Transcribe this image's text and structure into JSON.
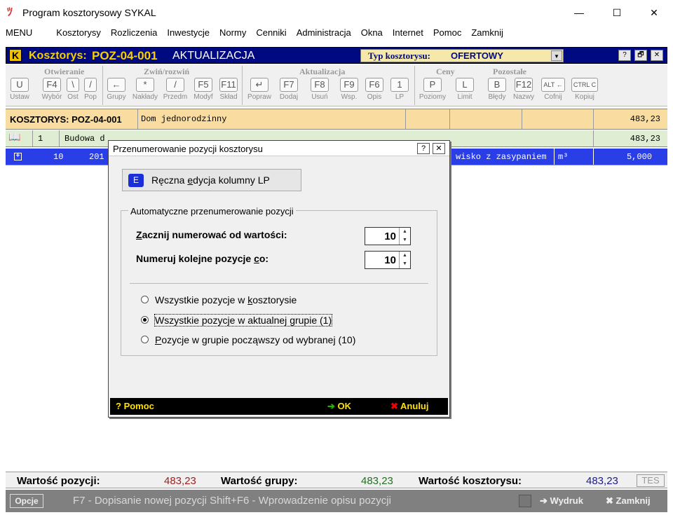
{
  "window": {
    "title": "Program kosztorysowy SYKAL",
    "minimize": "—",
    "maximize": "☐",
    "close": "✕"
  },
  "menu": [
    "MENU",
    "Kosztorysy",
    "Rozliczenia",
    "Inwestycje",
    "Normy",
    "Cenniki",
    "Administracja",
    "Okna",
    "Internet",
    "Pomoc",
    "Zamknij"
  ],
  "header": {
    "logo": "K",
    "label": "Kosztorys:",
    "code": "POZ-04-001",
    "mode": "AKTUALIZACJA",
    "typ_label": "Typ kosztorysu:",
    "typ_value": "OFERTOWY",
    "btn_help": "?",
    "btn_restore": "🗗",
    "btn_close": "✕"
  },
  "toolbar": {
    "groups": [
      "Otwieranie",
      "Zwiń/rozwiń",
      "Aktualizacja",
      "Ceny",
      "Pozostałe"
    ],
    "buttons": [
      {
        "key": "U",
        "label": "Ustaw"
      },
      {
        "key": "F4",
        "label": "Wybór"
      },
      {
        "key": "\\",
        "label": "Ost"
      },
      {
        "key": "/",
        "label": "Pop"
      },
      {
        "key": "←",
        "label": "Grupy"
      },
      {
        "key": "*",
        "label": "Nakłady"
      },
      {
        "key": "/",
        "label": "Przedm"
      },
      {
        "key": "F5",
        "label": "Modyf"
      },
      {
        "key": "F11",
        "label": "Skład"
      },
      {
        "key": "↵",
        "label": "Popraw"
      },
      {
        "key": "F7",
        "label": "Dodaj"
      },
      {
        "key": "F8",
        "label": "Usuń"
      },
      {
        "key": "F9",
        "label": "Wsp."
      },
      {
        "key": "F6",
        "label": "Opis"
      },
      {
        "key": "1",
        "label": "LP"
      },
      {
        "key": "P",
        "label": "Poziomy"
      },
      {
        "key": "L",
        "label": "Limit"
      },
      {
        "key": "B",
        "label": "Błędy"
      },
      {
        "key": "F12",
        "label": "Nazwy"
      },
      {
        "key": "ALT ←",
        "label": "Cofnij"
      },
      {
        "key": "CTRL C",
        "label": "Kopiuj"
      }
    ]
  },
  "table": {
    "row_kosztorys": {
      "label": "KOSZTORYS: POZ-04-001",
      "name": "Dom jednorodzinny",
      "value": "483,23"
    },
    "row_group": {
      "icon": "📖",
      "num": "1",
      "name": "Budowa d",
      "value": "483,23"
    },
    "row_selected": {
      "num": "10",
      "code": "201",
      "desc": "wisko z zasypaniem",
      "unit": "m³",
      "value": "5,000"
    }
  },
  "dialog": {
    "title": "Przenumerowanie pozycji kosztorysu",
    "help_btn": "?",
    "close_btn": "✕",
    "edit_key": "E",
    "edit_label_pre": "Ręczna ",
    "edit_label_u": "e",
    "edit_label_post": "dycja kolumny LP",
    "group_title": "Automatyczne przenumerowanie pozycji",
    "start_label_u": "Z",
    "start_label_post": "acznij numerować od wartości:",
    "start_value": "10",
    "step_label_pre": "Numeruj kolejne pozycje ",
    "step_label_u": "c",
    "step_label_post": "o:",
    "step_value": "10",
    "options": [
      {
        "pre": "Wszystkie pozycje w ",
        "u": "k",
        "post": "osztorysie",
        "selected": false
      },
      {
        "pre": "Wszystkie pozycje w aktualnej ",
        "u": "g",
        "post": "rupie (1)",
        "selected": true
      },
      {
        "pre": "",
        "u": "P",
        "post": "ozycje w grupie począwszy od wybranej (10)",
        "selected": false
      }
    ],
    "help": "Pomoc",
    "ok": "OK",
    "cancel": "Anuluj"
  },
  "status": {
    "pos_label": "Wartość pozycji:",
    "pos_value": "483,23",
    "grp_label": "Wartość grupy:",
    "grp_value": "483,23",
    "ksz_label": "Wartość kosztorysu:",
    "ksz_value": "483,23",
    "tes": "TES",
    "options_btn": "Opcje",
    "hint": "F7 - Dopisanie nowej pozycji   Shift+F6 - Wprowadzenie opisu pozycji",
    "print": "Wydruk",
    "close": "Zamknij"
  },
  "colors": {
    "pos_value": "#a02020",
    "grp_value": "#207020",
    "ksz_value": "#1a1a90"
  }
}
